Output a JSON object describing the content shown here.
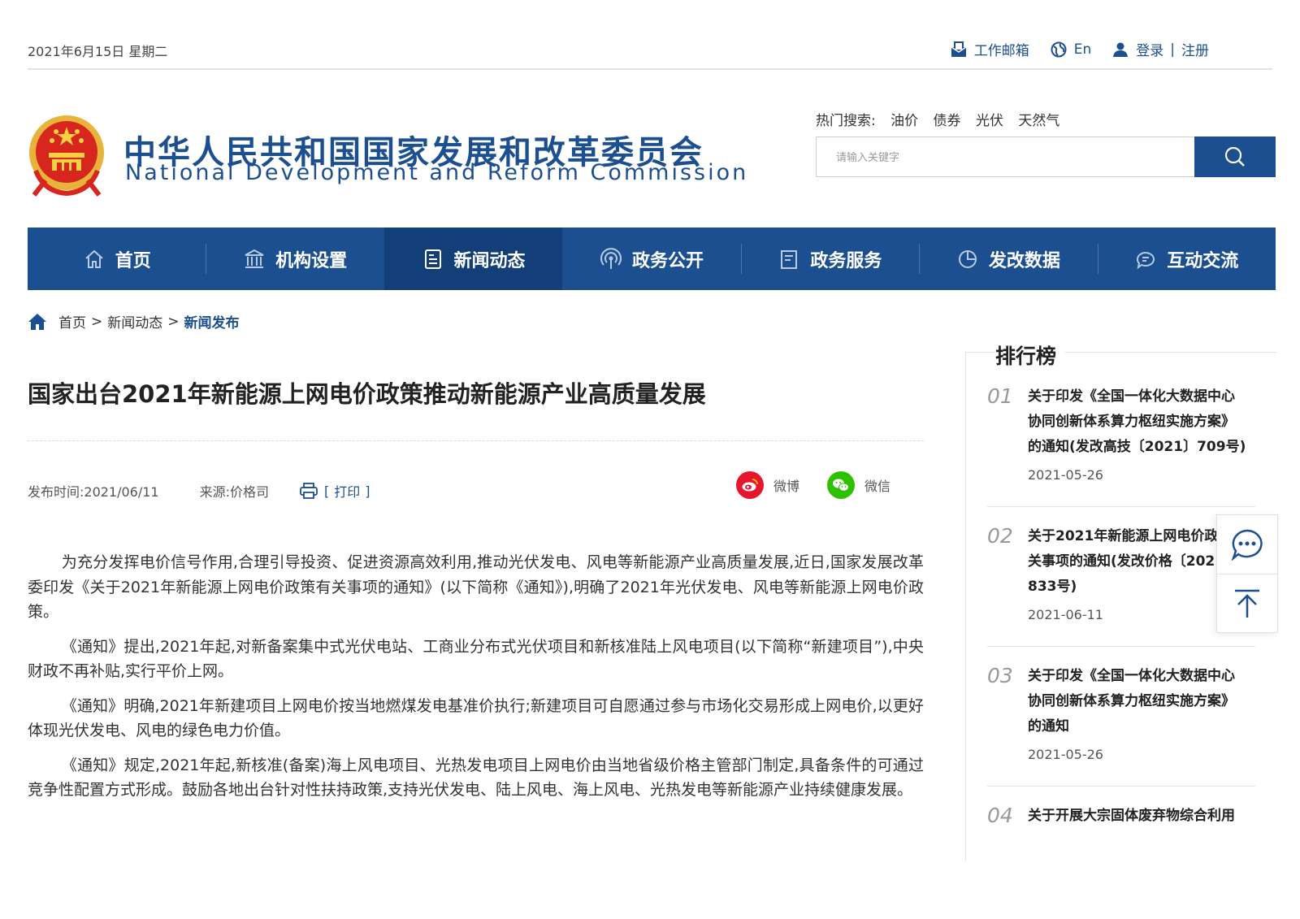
{
  "topbar": {
    "date": "2021年6月15日  星期二",
    "mail": "工作邮箱",
    "lang": "En",
    "login": "登录",
    "divider": "|",
    "register": "注册"
  },
  "header": {
    "title_cn": "中华人民共和国国家发展和改革委员会",
    "title_en": "National Development and Reform Commission",
    "hot_label": "热门搜索:",
    "hot_words": [
      "油价",
      "债券",
      "光伏",
      "天然气"
    ],
    "search_placeholder": "请输入关键字"
  },
  "nav": [
    {
      "label": "首页",
      "icon": "home-icon"
    },
    {
      "label": "机构设置",
      "icon": "institution-icon"
    },
    {
      "label": "新闻动态",
      "icon": "news-icon",
      "active": true
    },
    {
      "label": "政务公开",
      "icon": "broadcast-icon"
    },
    {
      "label": "政务服务",
      "icon": "document-icon"
    },
    {
      "label": "发改数据",
      "icon": "pie-chart-icon"
    },
    {
      "label": "互动交流",
      "icon": "chat-icon"
    }
  ],
  "breadcrumb": {
    "home": "首页",
    "sep": ">",
    "level1": "新闻动态",
    "current": "新闻发布"
  },
  "article": {
    "title": "国家出台2021年新能源上网电价政策推动新能源产业高质量发展",
    "publish_time": "发布时间:2021/06/11",
    "source": "来源:价格司",
    "print_open": "[",
    "print": "打印",
    "print_close": "]",
    "share_weibo": "微博",
    "share_wechat": "微信",
    "paragraphs": [
      "为充分发挥电价信号作用,合理引导投资、促进资源高效利用,推动光伏发电、风电等新能源产业高质量发展,近日,国家发展改革委印发《关于2021年新能源上网电价政策有关事项的通知》(以下简称《通知》),明确了2021年光伏发电、风电等新能源上网电价政策。",
      "《通知》提出,2021年起,对新备案集中式光伏电站、工商业分布式光伏项目和新核准陆上风电项目(以下简称“新建项目”),中央财政不再补贴,实行平价上网。",
      "《通知》明确,2021年新建项目上网电价按当地燃煤发电基准价执行;新建项目可自愿通过参与市场化交易形成上网电价,以更好体现光伏发电、风电的绿色电力价值。",
      "《通知》规定,2021年起,新核准(备案)海上风电项目、光热发电项目上网电价由当地省级价格主管部门制定,具备条件的可通过竞争性配置方式形成。鼓励各地出台针对性扶持政策,支持光伏发电、陆上风电、海上风电、光热发电等新能源产业持续健康发展。"
    ]
  },
  "ranking": {
    "title": "排行榜",
    "items": [
      {
        "num": "01",
        "lines": [
          "关于印发《全国一体化大数据中心",
          "协同创新体系算力枢纽实施方案》",
          "的通知(发改高技〔2021〕709号)"
        ],
        "date": "2021-05-26"
      },
      {
        "num": "02",
        "lines": [
          "关于2021年新能源上网电价政策有",
          "关事项的通知(发改价格〔2021〕",
          "833号)"
        ],
        "date": "2021-06-11"
      },
      {
        "num": "03",
        "lines": [
          "关于印发《全国一体化大数据中心",
          "协同创新体系算力枢纽实施方案》",
          "的通知"
        ],
        "date": "2021-05-26"
      },
      {
        "num": "04",
        "lines": [
          "关于开展大宗固体废弃物综合利用"
        ],
        "date": ""
      }
    ]
  },
  "colors": {
    "brand": "#1b4f8f",
    "nav_active": "#123f78",
    "weibo": "#e6162d",
    "wechat": "#2dc100"
  }
}
